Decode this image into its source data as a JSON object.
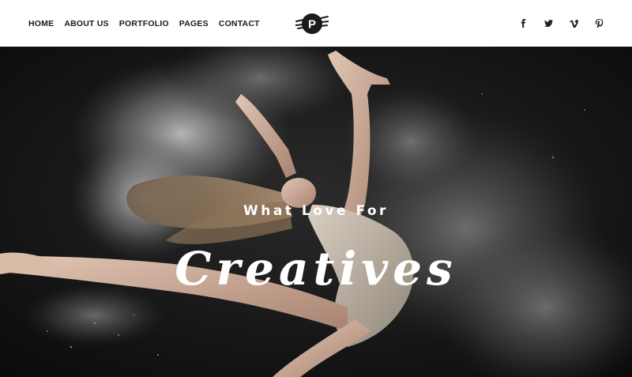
{
  "nav": {
    "items": [
      {
        "label": "HOME"
      },
      {
        "label": "ABOUT US"
      },
      {
        "label": "PORTFOLIO"
      },
      {
        "label": "PAGES"
      },
      {
        "label": "CONTACT"
      }
    ]
  },
  "logo": {
    "letter": "P",
    "icon": "p-logo-icon"
  },
  "social": {
    "icons": [
      "facebook-icon",
      "twitter-icon",
      "vimeo-icon",
      "pinterest-icon"
    ]
  },
  "hero": {
    "subtitle": "What Love For",
    "title": "Creatives",
    "image": "dancer-powder-image"
  },
  "colors": {
    "header_bg": "#ffffff",
    "hero_bg": "#141414",
    "text_dark": "#1b1b1b",
    "text_light": "#ffffff"
  }
}
